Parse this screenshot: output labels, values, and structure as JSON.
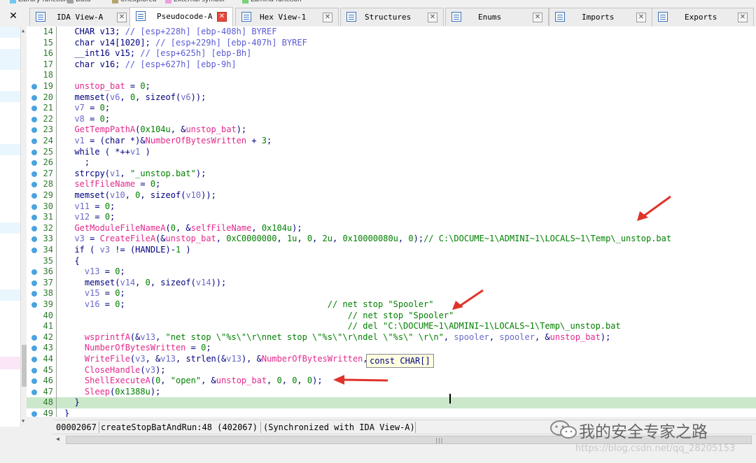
{
  "legend": [
    {
      "label": "Library function",
      "color": "#6fc7f4"
    },
    {
      "label": "Data",
      "color": "#a0a0a0"
    },
    {
      "label": "Unexplored",
      "color": "#b8a46a"
    },
    {
      "label": "External symbol",
      "color": "#f09bde"
    },
    {
      "label": "Lumina function",
      "color": "#7ad07a"
    }
  ],
  "sidebar": {
    "close_glyph": "✕"
  },
  "tabs": [
    {
      "label": "IDA View-A",
      "active": false
    },
    {
      "label": "Pseudocode-A",
      "active": true
    },
    {
      "label": "Hex View-1",
      "active": false
    },
    {
      "label": "Structures",
      "active": false
    },
    {
      "label": "Enums",
      "active": false
    },
    {
      "label": "Imports",
      "active": false
    },
    {
      "label": "Exports",
      "active": false
    }
  ],
  "code_lines": [
    {
      "n": "14",
      "bp": false,
      "hl": false,
      "toks": [
        [
          "kw",
          "  CHAR v13; "
        ],
        [
          "cm",
          "// [esp+228h] [ebp-408h] BYREF"
        ]
      ]
    },
    {
      "n": "15",
      "bp": false,
      "hl": false,
      "toks": [
        [
          "kw",
          "  char v14[1020]; "
        ],
        [
          "cm",
          "// [esp+229h] [ebp-407h] BYREF"
        ]
      ]
    },
    {
      "n": "16",
      "bp": false,
      "hl": false,
      "toks": [
        [
          "kw",
          "  __int16 v15; "
        ],
        [
          "cm",
          "// [esp+625h] [ebp-Bh]"
        ]
      ]
    },
    {
      "n": "17",
      "bp": false,
      "hl": false,
      "toks": [
        [
          "kw",
          "  char v16; "
        ],
        [
          "cm",
          "// [esp+627h] [ebp-9h]"
        ]
      ]
    },
    {
      "n": "18",
      "bp": false,
      "hl": false,
      "toks": []
    },
    {
      "n": "19",
      "bp": true,
      "hl": false,
      "toks": [
        [
          "gl",
          "  unstop_bat"
        ],
        [
          "pu",
          " = "
        ],
        [
          "nm",
          "0"
        ],
        [
          "pu",
          ";"
        ]
      ]
    },
    {
      "n": "20",
      "bp": true,
      "hl": false,
      "toks": [
        [
          "fb",
          "  memset"
        ],
        [
          "pu",
          "("
        ],
        [
          "vr",
          "v6"
        ],
        [
          "pu",
          ", "
        ],
        [
          "nm",
          "0"
        ],
        [
          "pu",
          ", sizeof("
        ],
        [
          "vr",
          "v6"
        ],
        [
          "pu",
          "));"
        ]
      ]
    },
    {
      "n": "21",
      "bp": true,
      "hl": false,
      "toks": [
        [
          "vr",
          "  v7"
        ],
        [
          "pu",
          " = "
        ],
        [
          "nm",
          "0"
        ],
        [
          "pu",
          ";"
        ]
      ]
    },
    {
      "n": "22",
      "bp": true,
      "hl": false,
      "toks": [
        [
          "vr",
          "  v8"
        ],
        [
          "pu",
          " = "
        ],
        [
          "nm",
          "0"
        ],
        [
          "pu",
          ";"
        ]
      ]
    },
    {
      "n": "23",
      "bp": true,
      "hl": false,
      "toks": [
        [
          "fn",
          "  GetTempPathA"
        ],
        [
          "pu",
          "("
        ],
        [
          "nm",
          "0x104u"
        ],
        [
          "pu",
          ", &"
        ],
        [
          "gl",
          "unstop_bat"
        ],
        [
          "pu",
          ");"
        ]
      ]
    },
    {
      "n": "24",
      "bp": true,
      "hl": false,
      "toks": [
        [
          "vr",
          "  v1"
        ],
        [
          "pu",
          " = (char *)&"
        ],
        [
          "gl",
          "NumberOfBytesWritten"
        ],
        [
          "pu",
          " + "
        ],
        [
          "nm",
          "3"
        ],
        [
          "pu",
          ";"
        ]
      ]
    },
    {
      "n": "25",
      "bp": true,
      "hl": false,
      "toks": [
        [
          "kw",
          "  while"
        ],
        [
          "pu",
          " ( *++"
        ],
        [
          "vr",
          "v1"
        ],
        [
          "pu",
          " )"
        ]
      ]
    },
    {
      "n": "26",
      "bp": true,
      "hl": false,
      "toks": [
        [
          "pu",
          "    ;"
        ]
      ]
    },
    {
      "n": "27",
      "bp": true,
      "hl": false,
      "toks": [
        [
          "fb",
          "  strcpy"
        ],
        [
          "pu",
          "("
        ],
        [
          "vr",
          "v1"
        ],
        [
          "pu",
          ", "
        ],
        [
          "st",
          "\"_unstop.bat\""
        ],
        [
          "pu",
          ");"
        ]
      ]
    },
    {
      "n": "28",
      "bp": true,
      "hl": false,
      "toks": [
        [
          "gl",
          "  selfFileName"
        ],
        [
          "pu",
          " = "
        ],
        [
          "nm",
          "0"
        ],
        [
          "pu",
          ";"
        ]
      ]
    },
    {
      "n": "29",
      "bp": true,
      "hl": false,
      "toks": [
        [
          "fb",
          "  memset"
        ],
        [
          "pu",
          "("
        ],
        [
          "vr",
          "v10"
        ],
        [
          "pu",
          ", "
        ],
        [
          "nm",
          "0"
        ],
        [
          "pu",
          ", sizeof("
        ],
        [
          "vr",
          "v10"
        ],
        [
          "pu",
          "));"
        ]
      ]
    },
    {
      "n": "30",
      "bp": true,
      "hl": false,
      "toks": [
        [
          "vr",
          "  v11"
        ],
        [
          "pu",
          " = "
        ],
        [
          "nm",
          "0"
        ],
        [
          "pu",
          ";"
        ]
      ]
    },
    {
      "n": "31",
      "bp": true,
      "hl": false,
      "toks": [
        [
          "vr",
          "  v12"
        ],
        [
          "pu",
          " = "
        ],
        [
          "nm",
          "0"
        ],
        [
          "pu",
          ";"
        ]
      ]
    },
    {
      "n": "32",
      "bp": true,
      "hl": false,
      "toks": [
        [
          "fn",
          "  GetModuleFileNameA"
        ],
        [
          "pu",
          "("
        ],
        [
          "nm",
          "0"
        ],
        [
          "pu",
          ", &"
        ],
        [
          "gl",
          "selfFileName"
        ],
        [
          "pu",
          ", "
        ],
        [
          "nm",
          "0x104u"
        ],
        [
          "pu",
          ");"
        ]
      ]
    },
    {
      "n": "33",
      "bp": true,
      "hl": false,
      "toks": [
        [
          "vr",
          "  v3"
        ],
        [
          "pu",
          " = "
        ],
        [
          "fn",
          "CreateFileA"
        ],
        [
          "pu",
          "(&"
        ],
        [
          "gl",
          "unstop_bat"
        ],
        [
          "pu",
          ", "
        ],
        [
          "nm",
          "0xC0000000"
        ],
        [
          "pu",
          ", "
        ],
        [
          "nm",
          "1u"
        ],
        [
          "pu",
          ", "
        ],
        [
          "nm",
          "0"
        ],
        [
          "pu",
          ", "
        ],
        [
          "nm",
          "2u"
        ],
        [
          "pu",
          ", "
        ],
        [
          "nm",
          "0x10000080u"
        ],
        [
          "pu",
          ", "
        ],
        [
          "nm",
          "0"
        ],
        [
          "pu",
          ");"
        ],
        [
          "st",
          "// C:\\DOCUME~1\\ADMINI~1\\LOCALS~1\\Temp\\_unstop.bat"
        ]
      ]
    },
    {
      "n": "34",
      "bp": true,
      "hl": false,
      "toks": [
        [
          "kw",
          "  if"
        ],
        [
          "pu",
          " ( "
        ],
        [
          "vr",
          "v3"
        ],
        [
          "pu",
          " != (HANDLE)-"
        ],
        [
          "nm",
          "1"
        ],
        [
          "pu",
          " )"
        ]
      ]
    },
    {
      "n": "35",
      "bp": false,
      "hl": false,
      "toks": [
        [
          "pu",
          "  {"
        ]
      ]
    },
    {
      "n": "36",
      "bp": true,
      "hl": false,
      "toks": [
        [
          "vr",
          "    v13"
        ],
        [
          "pu",
          " = "
        ],
        [
          "nm",
          "0"
        ],
        [
          "pu",
          ";"
        ]
      ]
    },
    {
      "n": "37",
      "bp": true,
      "hl": false,
      "toks": [
        [
          "fb",
          "    memset"
        ],
        [
          "pu",
          "("
        ],
        [
          "vr",
          "v14"
        ],
        [
          "pu",
          ", "
        ],
        [
          "nm",
          "0"
        ],
        [
          "pu",
          ", sizeof("
        ],
        [
          "vr",
          "v14"
        ],
        [
          "pu",
          "));"
        ]
      ]
    },
    {
      "n": "38",
      "bp": true,
      "hl": false,
      "toks": [
        [
          "vr",
          "    v15"
        ],
        [
          "pu",
          " = "
        ],
        [
          "nm",
          "0"
        ],
        [
          "pu",
          ";"
        ]
      ]
    },
    {
      "n": "39",
      "bp": true,
      "hl": false,
      "toks": [
        [
          "vr",
          "    v16"
        ],
        [
          "pu",
          " = "
        ],
        [
          "nm",
          "0"
        ],
        [
          "pu",
          ";                                        "
        ],
        [
          "st",
          "// net stop \"Spooler\""
        ]
      ]
    },
    {
      "n": "40",
      "bp": false,
      "hl": false,
      "toks": [
        [
          "pu",
          "                                                        "
        ],
        [
          "st",
          "// net stop \"Spooler\""
        ]
      ]
    },
    {
      "n": "41",
      "bp": false,
      "hl": false,
      "toks": [
        [
          "pu",
          "                                                        "
        ],
        [
          "st",
          "// del \"C:\\DOCUME~1\\ADMINI~1\\LOCALS~1\\Temp\\_unstop.bat"
        ]
      ]
    },
    {
      "n": "42",
      "bp": true,
      "hl": false,
      "toks": [
        [
          "fn",
          "    wsprintfA"
        ],
        [
          "pu",
          "(&"
        ],
        [
          "vr",
          "v13"
        ],
        [
          "pu",
          ", "
        ],
        [
          "st",
          "\"net stop \\\"%s\\\"\\r\\nnet stop \\\"%s\\\"\\r\\ndel \\\"%s\\\" \\r\\n\""
        ],
        [
          "pu",
          ", "
        ],
        [
          "vr",
          "spooler"
        ],
        [
          "pu",
          ", "
        ],
        [
          "vr",
          "spooler"
        ],
        [
          "pu",
          ", &"
        ],
        [
          "gl",
          "unstop_bat"
        ],
        [
          "pu",
          ");"
        ]
      ]
    },
    {
      "n": "43",
      "bp": true,
      "hl": false,
      "toks": [
        [
          "gl",
          "    NumberOfBytesWritten"
        ],
        [
          "pu",
          " = "
        ],
        [
          "nm",
          "0"
        ],
        [
          "pu",
          ";"
        ]
      ]
    },
    {
      "n": "44",
      "bp": true,
      "hl": false,
      "toks": [
        [
          "fn",
          "    WriteFile"
        ],
        [
          "pu",
          "("
        ],
        [
          "vr",
          "v3"
        ],
        [
          "pu",
          ", &"
        ],
        [
          "vr",
          "v13"
        ],
        [
          "pu",
          ", "
        ],
        [
          "fb",
          "strlen"
        ],
        [
          "pu",
          "(&"
        ],
        [
          "vr",
          "v13"
        ],
        [
          "pu",
          "), &"
        ],
        [
          "gl",
          "NumberOfBytesWritten"
        ],
        [
          "pu",
          ", "
        ],
        [
          "nm",
          "0"
        ],
        [
          "pu",
          ");"
        ]
      ]
    },
    {
      "n": "45",
      "bp": true,
      "hl": false,
      "toks": [
        [
          "fn",
          "    CloseHandle"
        ],
        [
          "pu",
          "("
        ],
        [
          "vr",
          "v3"
        ],
        [
          "pu",
          ");"
        ]
      ]
    },
    {
      "n": "46",
      "bp": true,
      "hl": false,
      "toks": [
        [
          "fn",
          "    ShellExecuteA"
        ],
        [
          "pu",
          "("
        ],
        [
          "nm",
          "0"
        ],
        [
          "pu",
          ", "
        ],
        [
          "st",
          "\"open\""
        ],
        [
          "pu",
          ", &"
        ],
        [
          "gl",
          "unstop_bat"
        ],
        [
          "pu",
          ", "
        ],
        [
          "nm",
          "0"
        ],
        [
          "pu",
          ", "
        ],
        [
          "nm",
          "0"
        ],
        [
          "pu",
          ", "
        ],
        [
          "nm",
          "0"
        ],
        [
          "pu",
          ");"
        ]
      ]
    },
    {
      "n": "47",
      "bp": true,
      "hl": false,
      "toks": [
        [
          "fn",
          "    Sleep"
        ],
        [
          "pu",
          "("
        ],
        [
          "nm",
          "0x1388u"
        ],
        [
          "pu",
          ");"
        ]
      ]
    },
    {
      "n": "48",
      "bp": false,
      "hl": true,
      "toks": [
        [
          "pu",
          "  }"
        ]
      ]
    },
    {
      "n": "49",
      "bp": true,
      "hl": false,
      "toks": [
        [
          "pu",
          "}"
        ]
      ]
    }
  ],
  "tooltip": "const CHAR[]",
  "status": {
    "address": "00002067",
    "location": "createStopBatAndRun:48 (402067)",
    "sync": "(Synchronized with IDA View-A)"
  },
  "watermark": {
    "text": "我的安全专家之路",
    "url": "https://blog.csdn.net/qq_28205153"
  },
  "colors": {
    "arrow": "#e0332a",
    "highlight": "#cbe8cb",
    "active_close": "#e8483a"
  }
}
